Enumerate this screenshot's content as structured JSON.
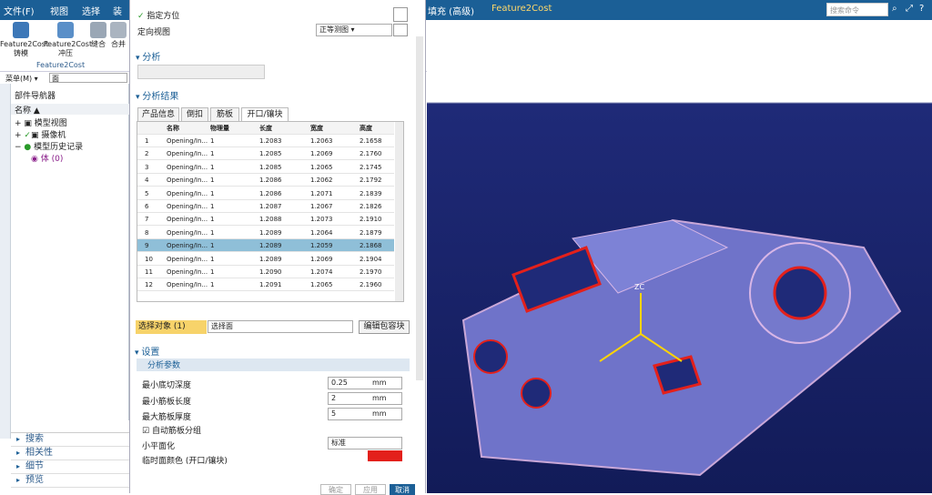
{
  "menubar": {
    "file": "文件(F)",
    "view": "视图",
    "select": "选择",
    "dress": "装",
    "fill": "填充 (高级)",
    "tab": "Feature2Cost",
    "search_placeholder": "搜索命令"
  },
  "toolbar": {
    "tools": [
      {
        "label": "Feature2Cost\n铸模"
      },
      {
        "label": "Feature2Cost\n冲压"
      },
      {
        "label": "缝合"
      },
      {
        "label": "合并"
      }
    ],
    "group_label": "Feature2Cost"
  },
  "filter": {
    "menu": "菜单(M) ▾",
    "type": "面"
  },
  "nav": {
    "title": "部件导航器",
    "col": "名称",
    "items": [
      "模型视图",
      "摄像机",
      "模型历史记录",
      "体 (0)"
    ],
    "sections": [
      "搜索",
      "相关性",
      "细节",
      "预览"
    ]
  },
  "dialog": {
    "orient": "指定方位",
    "orient_view": "定向视图",
    "view_value": "正等测图",
    "analysis": "分析",
    "results": "分析结果",
    "tabs": [
      "产品信息",
      "倒扣",
      "筋板",
      "开口/镶块"
    ],
    "columns": [
      "名称",
      "物理量",
      "长度",
      "宽度",
      "高度"
    ],
    "rows": [
      [
        "1",
        "Opening/In...",
        "1",
        "1.2083",
        "1.2063",
        "2.1658"
      ],
      [
        "2",
        "Opening/In...",
        "1",
        "1.2085",
        "1.2069",
        "2.1760"
      ],
      [
        "3",
        "Opening/In...",
        "1",
        "1.2085",
        "1.2065",
        "2.1745"
      ],
      [
        "4",
        "Opening/In...",
        "1",
        "1.2086",
        "1.2062",
        "2.1792"
      ],
      [
        "5",
        "Opening/In...",
        "1",
        "1.2086",
        "1.2071",
        "2.1839"
      ],
      [
        "6",
        "Opening/In...",
        "1",
        "1.2087",
        "1.2067",
        "2.1826"
      ],
      [
        "7",
        "Opening/In...",
        "1",
        "1.2088",
        "1.2073",
        "2.1910"
      ],
      [
        "8",
        "Opening/In...",
        "1",
        "1.2089",
        "1.2064",
        "2.1879"
      ],
      [
        "9",
        "Opening/In...",
        "1",
        "1.2089",
        "1.2059",
        "2.1868"
      ],
      [
        "10",
        "Opening/In...",
        "1",
        "1.2089",
        "1.2069",
        "2.1904"
      ],
      [
        "11",
        "Opening/In...",
        "1",
        "1.2090",
        "1.2074",
        "2.1970"
      ],
      [
        "12",
        "Opening/In...",
        "1",
        "1.2091",
        "1.2065",
        "2.1960"
      ]
    ],
    "selected_row": "9",
    "select_obj": "选择对象 (1)",
    "select_face": "选择面",
    "edit_btn": "编辑包容块",
    "settings": "设置",
    "params": "分析参数",
    "min_undercut": "最小底切深度",
    "min_rib_len": "最小筋板长度",
    "max_rib_thick": "最大筋板厚度",
    "min_undercut_val": "0.25",
    "min_rib_len_val": "2",
    "max_rib_thick_val": "5",
    "unit": "mm",
    "auto_rib": "自动筋板分组",
    "small_plane": "小平面化",
    "small_plane_val": "标准",
    "temp_color": "临时面颜色 (开口/镶块)",
    "temp_color_hex": "#e3201b",
    "ok": "确定",
    "apply": "应用",
    "cancel": "取消"
  },
  "viewport": {
    "axis_label": "ZC"
  }
}
